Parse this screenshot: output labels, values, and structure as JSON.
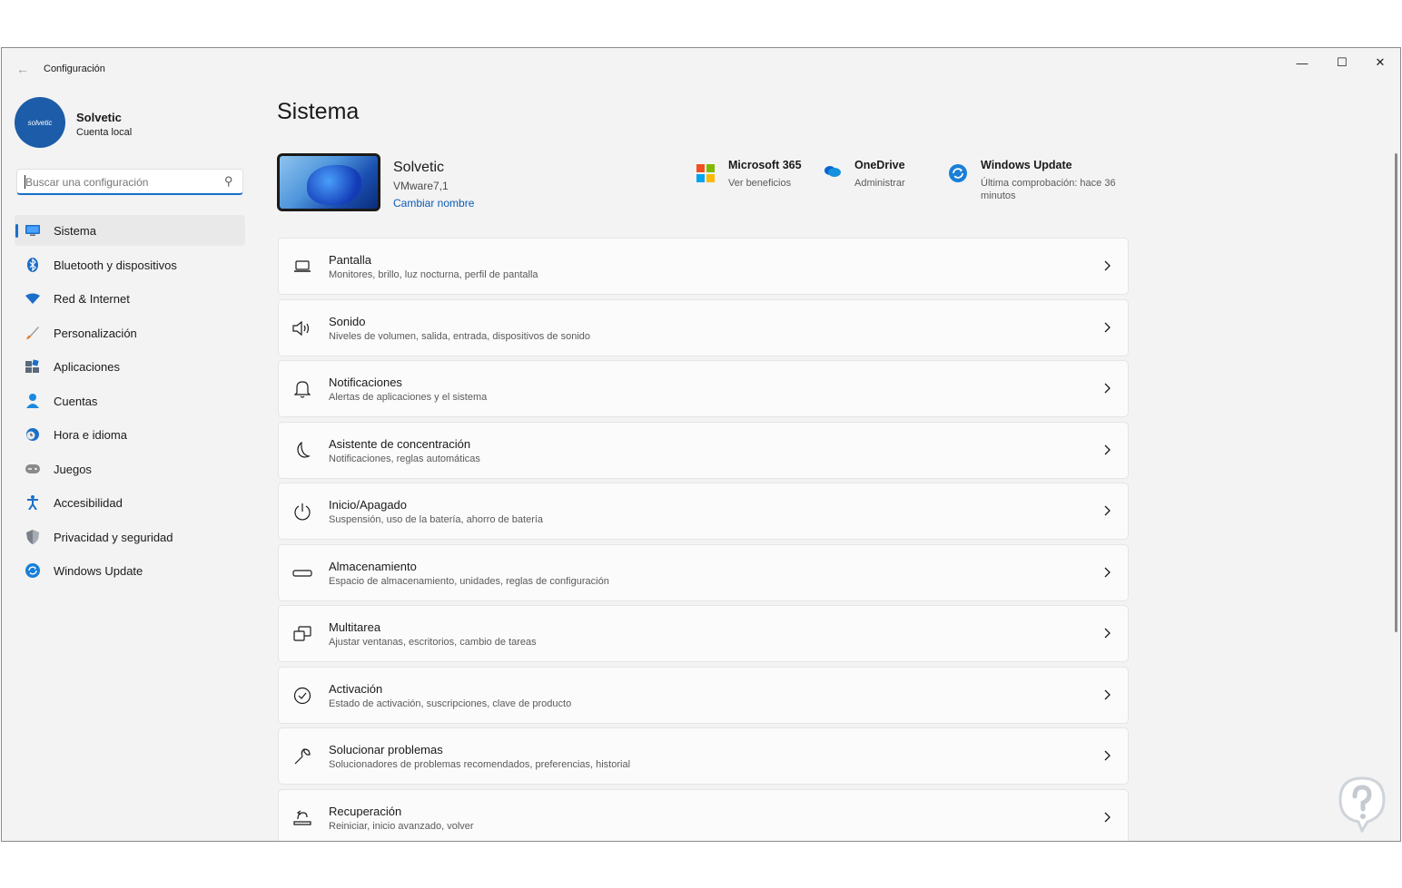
{
  "window": {
    "app_title": "Configuración",
    "controls": {
      "minimize": "—",
      "maximize": "☐",
      "close": "✕"
    }
  },
  "profile": {
    "avatar_text": "solvetic",
    "name": "Solvetic",
    "account_type": "Cuenta local"
  },
  "search": {
    "placeholder": "Buscar una configuración"
  },
  "nav": {
    "items": [
      {
        "label": "Sistema",
        "icon": "monitor-icon",
        "active": true
      },
      {
        "label": "Bluetooth y dispositivos",
        "icon": "bluetooth-icon"
      },
      {
        "label": "Red & Internet",
        "icon": "wifi-icon"
      },
      {
        "label": "Personalización",
        "icon": "brush-icon"
      },
      {
        "label": "Aplicaciones",
        "icon": "apps-icon"
      },
      {
        "label": "Cuentas",
        "icon": "person-icon"
      },
      {
        "label": "Hora e idioma",
        "icon": "clock-globe-icon"
      },
      {
        "label": "Juegos",
        "icon": "gamepad-icon"
      },
      {
        "label": "Accesibilidad",
        "icon": "accessibility-icon"
      },
      {
        "label": "Privacidad y seguridad",
        "icon": "shield-icon"
      },
      {
        "label": "Windows Update",
        "icon": "sync-icon"
      }
    ]
  },
  "main": {
    "title": "Sistema",
    "device": {
      "name": "Solvetic",
      "model": "VMware7,1",
      "rename_link": "Cambiar nombre"
    },
    "quick_tiles": [
      {
        "title": "Microsoft 365",
        "sub": "Ver beneficios",
        "icon": "microsoft-logo-icon"
      },
      {
        "title": "OneDrive",
        "sub": "Administrar",
        "icon": "cloud-icon"
      },
      {
        "title": "Windows Update",
        "sub": "Última comprobación: hace 36 minutos",
        "icon": "sync-icon"
      }
    ],
    "cards": [
      {
        "title": "Pantalla",
        "sub": "Monitores, brillo, luz nocturna, perfil de pantalla",
        "icon": "laptop-icon"
      },
      {
        "title": "Sonido",
        "sub": "Niveles de volumen, salida, entrada, dispositivos de sonido",
        "icon": "speaker-icon"
      },
      {
        "title": "Notificaciones",
        "sub": "Alertas de aplicaciones y el sistema",
        "icon": "bell-icon"
      },
      {
        "title": "Asistente de concentración",
        "sub": "Notificaciones, reglas automáticas",
        "icon": "moon-icon"
      },
      {
        "title": "Inicio/Apagado",
        "sub": "Suspensión, uso de la batería, ahorro de batería",
        "icon": "power-icon"
      },
      {
        "title": "Almacenamiento",
        "sub": "Espacio de almacenamiento, unidades, reglas de configuración",
        "icon": "drive-icon"
      },
      {
        "title": "Multitarea",
        "sub": "Ajustar ventanas, escritorios, cambio de tareas",
        "icon": "multitask-icon"
      },
      {
        "title": "Activación",
        "sub": "Estado de activación, suscripciones, clave de producto",
        "icon": "check-circle-icon"
      },
      {
        "title": "Solucionar problemas",
        "sub": "Solucionadores de problemas recomendados, preferencias, historial",
        "icon": "wrench-icon"
      },
      {
        "title": "Recuperación",
        "sub": "Reiniciar, inicio avanzado, volver",
        "icon": "recovery-icon"
      }
    ]
  },
  "colors": {
    "accent": "#1a6fc9",
    "link": "#0a5cb8",
    "background": "#f3f3f3",
    "card": "#fbfbfb"
  }
}
